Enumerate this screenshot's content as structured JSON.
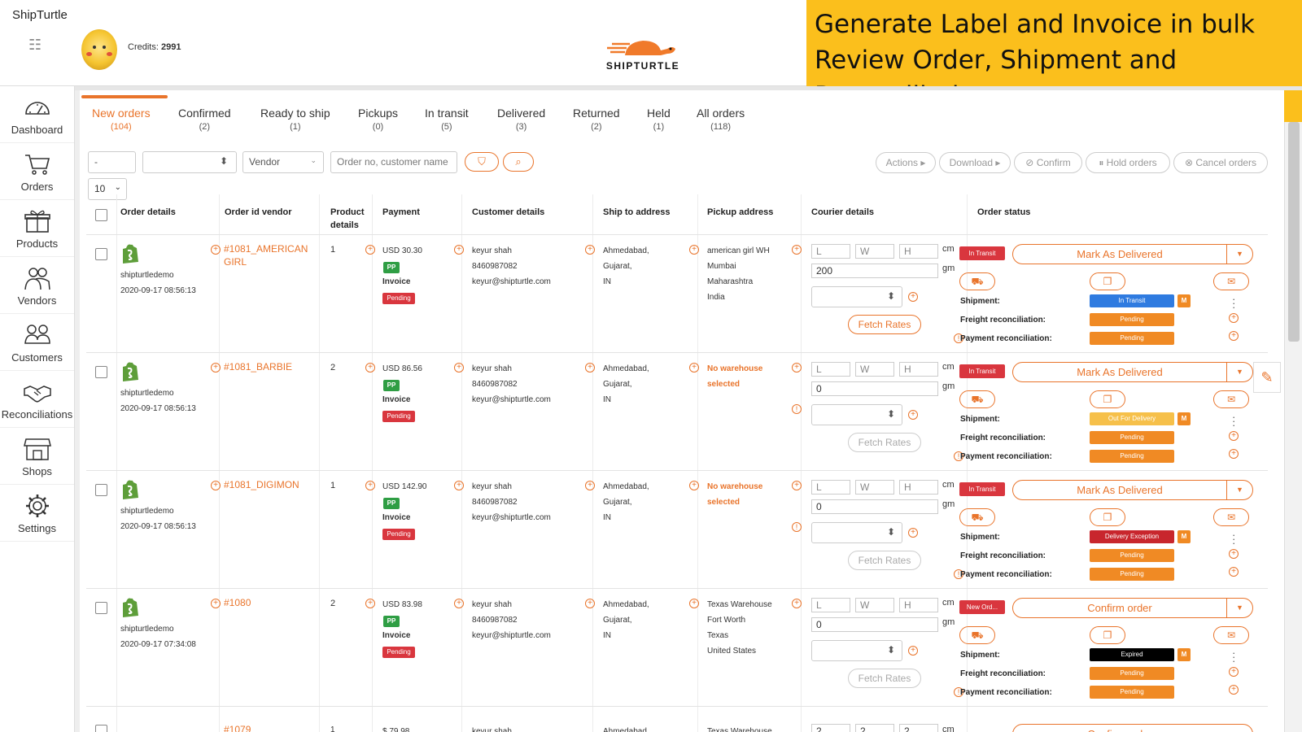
{
  "header": {
    "app_title": "ShipTurtle",
    "credits_label": "Credits:",
    "credits_value": "2991",
    "logo_text": "SHIPTURTLE"
  },
  "callout": {
    "lines": [
      "Generate Label and Invoice in bulk",
      "Review Order, Shipment and",
      "Reconciliation status"
    ]
  },
  "sidebar": {
    "items": [
      {
        "label": "Dashboard",
        "icon": "speedometer-icon"
      },
      {
        "label": "Orders",
        "icon": "cart-icon"
      },
      {
        "label": "Products",
        "icon": "gift-icon"
      },
      {
        "label": "Vendors",
        "icon": "people-icon"
      },
      {
        "label": "Customers",
        "icon": "customers-icon"
      },
      {
        "label": "Reconciliations",
        "icon": "handshake-icon"
      },
      {
        "label": "Shops",
        "icon": "store-icon"
      },
      {
        "label": "Settings",
        "icon": "gear-icon"
      }
    ]
  },
  "tabs": [
    {
      "label": "New orders",
      "count": "(104)"
    },
    {
      "label": "Confirmed",
      "count": "(2)"
    },
    {
      "label": "Ready to ship",
      "count": "(1)"
    },
    {
      "label": "Pickups",
      "count": "(0)"
    },
    {
      "label": "In transit",
      "count": "(5)"
    },
    {
      "label": "Delivered",
      "count": "(3)"
    },
    {
      "label": "Returned",
      "count": "(2)"
    },
    {
      "label": "Held",
      "count": "(1)"
    },
    {
      "label": "All orders",
      "count": "(118)"
    }
  ],
  "filters": {
    "dash_value": "-",
    "vendor_placeholder": "Vendor",
    "search_placeholder": "Order no, customer name",
    "page_size": "10",
    "actions": "Actions ▸",
    "download": "Download ▸",
    "confirm": "Confirm",
    "hold_orders": "Hold orders",
    "cancel_orders": "Cancel orders"
  },
  "columns": [
    "Order details",
    "Order id vendor",
    "Product details",
    "Payment",
    "Customer details",
    "Ship to address",
    "Pickup address",
    "Courier details",
    "Order status"
  ],
  "labels": {
    "invoice": "Invoice",
    "pp": "PP",
    "pending": "Pending",
    "cm": "cm",
    "gm": "gm",
    "fetch_rates": "Fetch Rates",
    "shipment": "Shipment:",
    "freight": "Freight reconciliation:",
    "payment_rec": "Payment reconciliation:",
    "m": "M",
    "dim_l": "L",
    "dim_w": "W",
    "dim_h": "H"
  },
  "orders": [
    {
      "shop": "shipturtledemo",
      "date": "2020-09-17 08:56:13",
      "order_id": "#1081_AMERICAN GIRL",
      "qty": "1",
      "amount": "USD 30.30",
      "customer": [
        "keyur shah",
        "8460987082",
        "keyur@shipturtle.com"
      ],
      "ship_to": [
        "Ahmedabad,",
        "Gujarat,",
        "IN"
      ],
      "pickup": [
        "american girl WH",
        "Mumbai",
        "Maharashtra",
        "India"
      ],
      "pickup_warn": false,
      "weight": "200",
      "fetch_active": true,
      "status_badge": "In Transit",
      "action": "Mark As Delivered",
      "shipment_status": "In Transit",
      "shipment_color": "#2f7be0",
      "freight": "Pending",
      "payment_rec": "Pending"
    },
    {
      "shop": "shipturtledemo",
      "date": "2020-09-17 08:56:13",
      "order_id": "#1081_BARBIE",
      "qty": "2",
      "amount": "USD 86.56",
      "customer": [
        "keyur shah",
        "8460987082",
        "keyur@shipturtle.com"
      ],
      "ship_to": [
        "Ahmedabad,",
        "Gujarat,",
        "IN"
      ],
      "pickup": [
        "No warehouse",
        "selected"
      ],
      "pickup_warn": true,
      "weight": "0",
      "fetch_active": false,
      "status_badge": "In Transit",
      "action": "Mark As Delivered",
      "shipment_status": "Out For Delivery",
      "shipment_color": "#f6c04a",
      "freight": "Pending",
      "payment_rec": "Pending"
    },
    {
      "shop": "shipturtledemo",
      "date": "2020-09-17 08:56:13",
      "order_id": "#1081_DIGIMON",
      "qty": "1",
      "amount": "USD 142.90",
      "customer": [
        "keyur shah",
        "8460987082",
        "keyur@shipturtle.com"
      ],
      "ship_to": [
        "Ahmedabad,",
        "Gujarat,",
        "IN"
      ],
      "pickup": [
        "No warehouse",
        "selected"
      ],
      "pickup_warn": true,
      "weight": "0",
      "fetch_active": false,
      "status_badge": "In Transit",
      "action": "Mark As Delivered",
      "shipment_status": "Delivery Exception",
      "shipment_color": "#c8262d",
      "freight": "Pending",
      "payment_rec": "Pending"
    },
    {
      "shop": "shipturtledemo",
      "date": "2020-09-17 07:34:08",
      "order_id": "#1080",
      "qty": "2",
      "amount": "USD 83.98",
      "customer": [
        "keyur shah",
        "8460987082",
        "keyur@shipturtle.com"
      ],
      "ship_to": [
        "Ahmedabad,",
        "Gujarat,",
        "IN"
      ],
      "pickup": [
        "Texas Warehouse",
        "Fort Worth",
        "Texas",
        "United States"
      ],
      "pickup_warn": false,
      "weight": "0",
      "fetch_active": false,
      "status_badge": "New Ord...",
      "action": "Confirm order",
      "shipment_status": "Expired",
      "shipment_color": "#000000",
      "freight": "Pending",
      "payment_rec": "Pending"
    }
  ],
  "partial_row": {
    "order_id": "#1079",
    "qty": "1",
    "amount": "$ 79.98",
    "customer": "keyur shah",
    "ship_to": "Ahmedabad",
    "pickup": "Texas Warehouse",
    "dim_l": "2",
    "dim_w": "2",
    "dim_h": "2",
    "cm": "cm",
    "action": "Confirm order"
  },
  "colors": {
    "accent": "#e9742b",
    "pending": "#f08a24",
    "danger": "#d9363e",
    "callout": "#fbbf1c"
  }
}
